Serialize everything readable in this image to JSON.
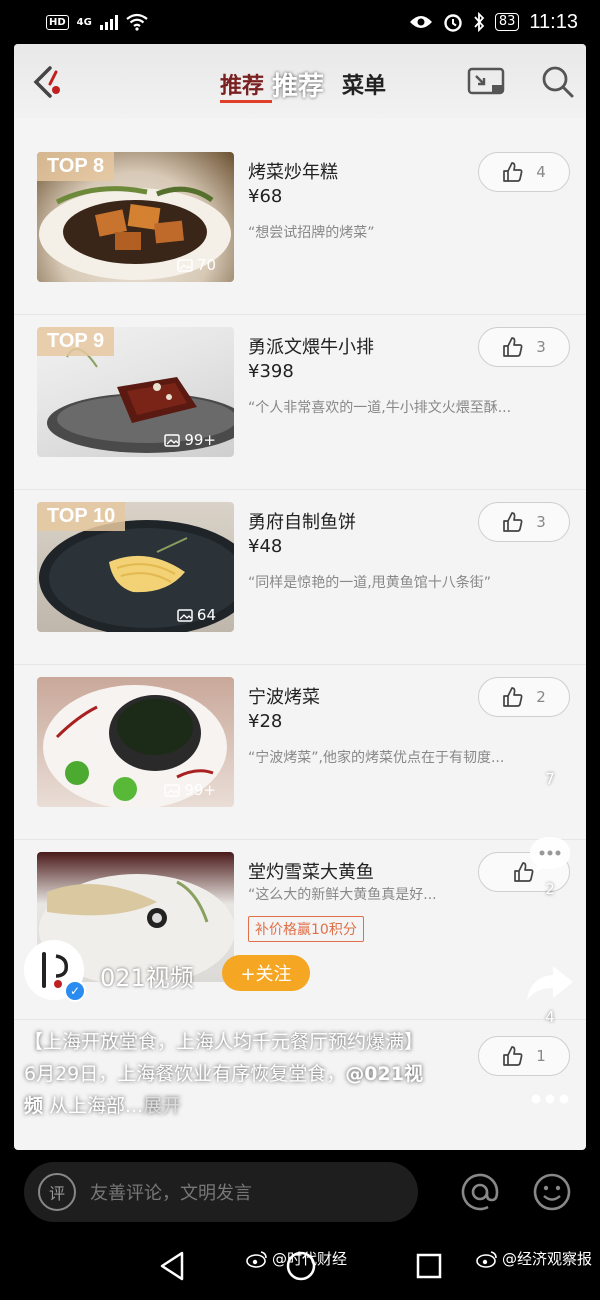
{
  "status_bar": {
    "hd": "HD",
    "network": "4G",
    "battery": "83",
    "time": "11:13"
  },
  "header": {
    "tab_recommend": "推荐",
    "tab_recommend_overlay": "推荐",
    "tab_menu": "菜单"
  },
  "dishes": [
    {
      "rank": "TOP 8",
      "name": "烤菜炒年糕",
      "price": "¥68",
      "quote": "“想尝试招牌的烤菜”",
      "photos": "70",
      "likes": "4"
    },
    {
      "rank": "TOP 9",
      "name": "勇派文煨牛小排",
      "price": "¥398",
      "quote": "“个人非常喜欢的一道,牛小排文火煨至酥...",
      "photos": "99+",
      "likes": "3"
    },
    {
      "rank": "TOP 10",
      "name": "勇府自制鱼饼",
      "price": "¥48",
      "quote": "“同样是惊艳的一道,甩黄鱼馆十八条街”",
      "photos": "64",
      "likes": "3"
    },
    {
      "rank": "",
      "name": "宁波烤菜",
      "price": "¥28",
      "quote": "“宁波烤菜”,他家的烤菜优点在于有韧度...",
      "photos": "99+",
      "likes": "2"
    },
    {
      "rank": "",
      "name": "堂灼雪菜大黄鱼",
      "price": "",
      "quote": "“这么大的新鲜大黄鱼真是好...",
      "photos": "",
      "likes": "",
      "points_tag": "补价格赢10积分"
    }
  ],
  "partial_row": {
    "likes": "1"
  },
  "author": {
    "name": "021视频",
    "follow_label": "+关注"
  },
  "caption": {
    "text_1": "【上海开放堂食，上海人均千元餐厅预约爆满】6月29日，上海餐饮业有序恢复堂食，",
    "mention": "@021视频",
    "text_2": " 从上海部...",
    "expand": "展开"
  },
  "side": {
    "count_top": "7",
    "comments": "2",
    "shares": "4"
  },
  "comment_bar": {
    "ping_label": "评",
    "placeholder": "友善评论，文明发言"
  },
  "watermarks": {
    "left": "@时代财经",
    "right": "@经济观察报"
  },
  "colors": {
    "accent": "#e0402a",
    "follow": "#f5a623",
    "verified": "#2a8cf0"
  }
}
